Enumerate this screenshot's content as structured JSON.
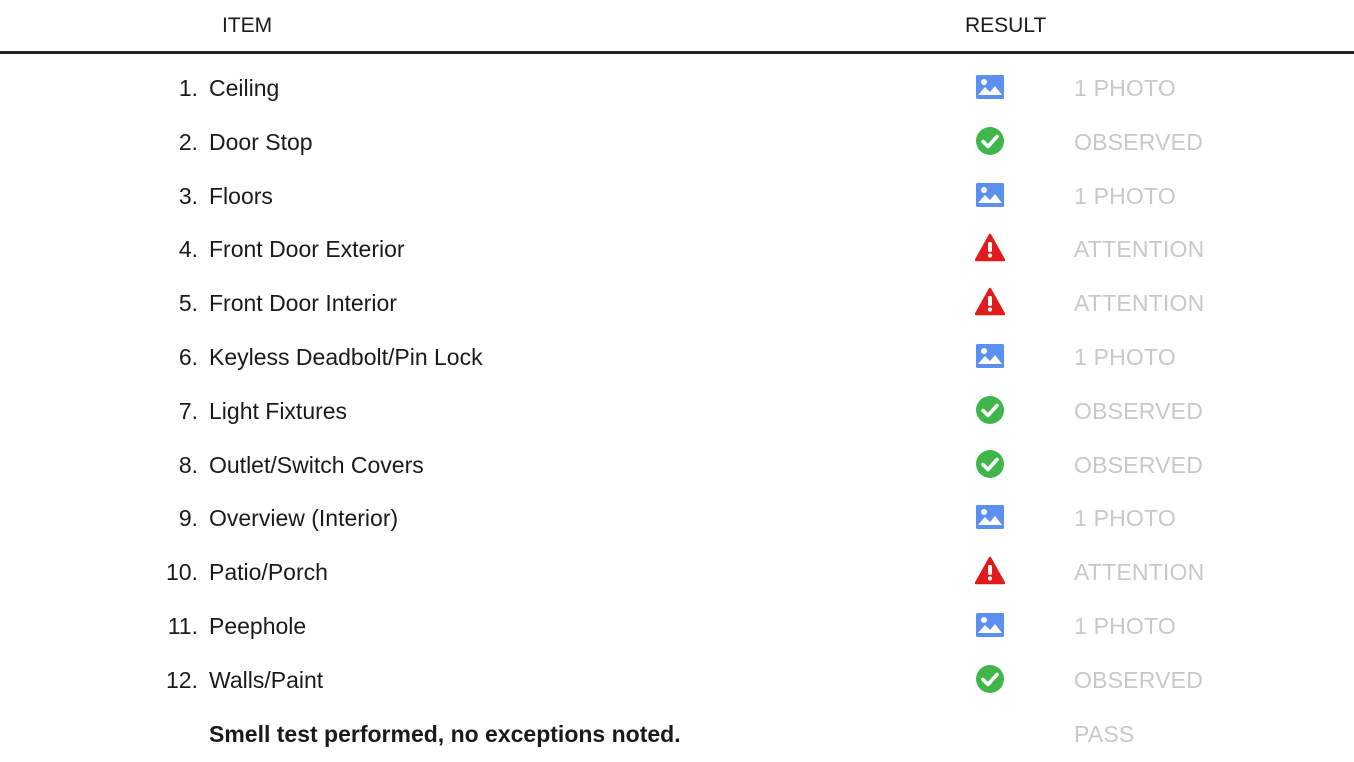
{
  "header": {
    "item": "ITEM",
    "result": "RESULT"
  },
  "colors": {
    "photo": "#5b8ff0",
    "observed": "#3fb64a",
    "attention": "#e11b1b",
    "result_text": "#c8c8c8"
  },
  "rows": [
    {
      "num": "1.",
      "label": "Ceiling",
      "icon": "photo-icon",
      "result": "1 PHOTO"
    },
    {
      "num": "2.",
      "label": "Door Stop",
      "icon": "check-icon",
      "result": "OBSERVED"
    },
    {
      "num": "3.",
      "label": "Floors",
      "icon": "photo-icon",
      "result": "1 PHOTO"
    },
    {
      "num": "4.",
      "label": "Front Door Exterior",
      "icon": "warning-icon",
      "result": "ATTENTION"
    },
    {
      "num": "5.",
      "label": "Front Door Interior",
      "icon": "warning-icon",
      "result": "ATTENTION"
    },
    {
      "num": "6.",
      "label": "Keyless Deadbolt/Pin Lock",
      "icon": "photo-icon",
      "result": "1 PHOTO"
    },
    {
      "num": "7.",
      "label": "Light Fixtures",
      "icon": "check-icon",
      "result": "OBSERVED"
    },
    {
      "num": "8.",
      "label": "Outlet/Switch Covers",
      "icon": "check-icon",
      "result": "OBSERVED"
    },
    {
      "num": "9.",
      "label": "Overview (Interior)",
      "icon": "photo-icon",
      "result": "1 PHOTO"
    },
    {
      "num": "10.",
      "label": "Patio/Porch",
      "icon": "warning-icon",
      "result": "ATTENTION"
    },
    {
      "num": "11.",
      "label": "Peephole",
      "icon": "photo-icon",
      "result": "1 PHOTO"
    },
    {
      "num": "12.",
      "label": "Walls/Paint",
      "icon": "check-icon",
      "result": "OBSERVED"
    }
  ],
  "summary": {
    "label": "Smell test performed, no exceptions noted.",
    "result": "PASS"
  }
}
